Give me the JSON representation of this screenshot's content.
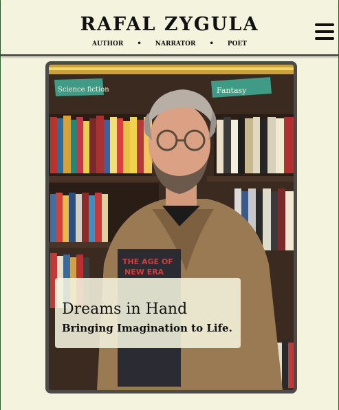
{
  "header": {
    "title": "RAFAL ZYGULA",
    "tagline": {
      "role_1": "AUTHOR",
      "role_2": "NARRATOR",
      "role_3": "POET",
      "separator": "•"
    },
    "menu_icon": "hamburger-menu-icon"
  },
  "hero": {
    "image_subject": "portrait photo in bookstore",
    "shelf_sign_left": "Science fiction",
    "shelf_sign_right": "Fantasy",
    "book_title": "THE AGE OF NEW ERA",
    "caption_title": "Dreams in Hand",
    "caption_subtitle": "Bringing Imagination to Life."
  },
  "colors": {
    "background": "#f4f4de",
    "frame": "#4b4b4b",
    "text": "#111111",
    "border": "#2d5a2d"
  }
}
